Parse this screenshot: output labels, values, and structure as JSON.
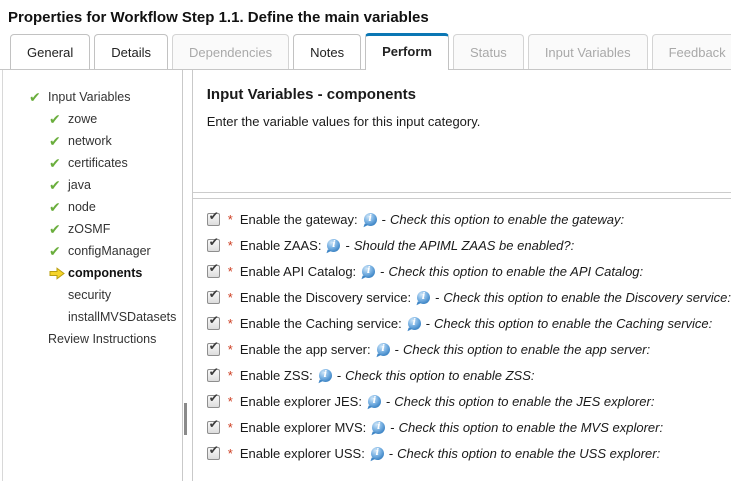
{
  "title": "Properties for Workflow Step 1.1. Define the main variables",
  "tabs": [
    {
      "label": "General",
      "state": "enabled"
    },
    {
      "label": "Details",
      "state": "enabled"
    },
    {
      "label": "Dependencies",
      "state": "disabled"
    },
    {
      "label": "Notes",
      "state": "enabled"
    },
    {
      "label": "Perform",
      "state": "active"
    },
    {
      "label": "Status",
      "state": "disabled"
    },
    {
      "label": "Input Variables",
      "state": "disabled"
    },
    {
      "label": "Feedback",
      "state": "disabled"
    }
  ],
  "sidebar": {
    "items": [
      {
        "label": "Input Variables",
        "icon": "check",
        "level": 0,
        "bold": false,
        "selected": false
      },
      {
        "label": "zowe",
        "icon": "check",
        "level": 1,
        "bold": false,
        "selected": false
      },
      {
        "label": "network",
        "icon": "check",
        "level": 1,
        "bold": false,
        "selected": false
      },
      {
        "label": "certificates",
        "icon": "check",
        "level": 1,
        "bold": false,
        "selected": false
      },
      {
        "label": "java",
        "icon": "check",
        "level": 1,
        "bold": false,
        "selected": false
      },
      {
        "label": "node",
        "icon": "check",
        "level": 1,
        "bold": false,
        "selected": false
      },
      {
        "label": "zOSMF",
        "icon": "check",
        "level": 1,
        "bold": false,
        "selected": false
      },
      {
        "label": "configManager",
        "icon": "check",
        "level": 1,
        "bold": false,
        "selected": false
      },
      {
        "label": "components",
        "icon": "arrow",
        "level": 1,
        "bold": true,
        "selected": true
      },
      {
        "label": "security",
        "icon": "none",
        "level": 1,
        "bold": false,
        "selected": false
      },
      {
        "label": "installMVSDatasets",
        "icon": "none",
        "level": 1,
        "bold": false,
        "selected": false
      },
      {
        "label": "Review Instructions",
        "icon": "none",
        "level": 0,
        "bold": false,
        "selected": false
      }
    ]
  },
  "main": {
    "heading": "Input Variables - components",
    "subheading": "Enter the variable values for this input category.",
    "required_marker": "*",
    "separator": "-",
    "rows": [
      {
        "label": "Enable the gateway:",
        "description": "Check this option to enable the gateway:",
        "checked": true,
        "required": true
      },
      {
        "label": "Enable ZAAS:",
        "description": "Should the APIML ZAAS be enabled?:",
        "checked": true,
        "required": true
      },
      {
        "label": "Enable API Catalog:",
        "description": "Check this option to enable the API Catalog:",
        "checked": true,
        "required": true
      },
      {
        "label": "Enable the Discovery service:",
        "description": "Check this option to enable the Discovery service:",
        "checked": true,
        "required": true
      },
      {
        "label": "Enable the Caching service:",
        "description": "Check this option to enable the Caching service:",
        "checked": true,
        "required": true
      },
      {
        "label": "Enable the app server:",
        "description": "Check this option to enable the app server:",
        "checked": true,
        "required": true
      },
      {
        "label": "Enable ZSS:",
        "description": "Check this option to enable ZSS:",
        "checked": true,
        "required": true
      },
      {
        "label": "Enable explorer JES:",
        "description": "Check this option to enable the JES explorer:",
        "checked": true,
        "required": true
      },
      {
        "label": "Enable explorer MVS:",
        "description": "Check this option to enable the MVS explorer:",
        "checked": true,
        "required": true
      },
      {
        "label": "Enable explorer USS:",
        "description": "Check this option to enable the USS explorer:",
        "checked": true,
        "required": true
      }
    ]
  },
  "icons": {
    "complete": "check-icon",
    "current": "arrow-right-icon",
    "help": "info-icon"
  },
  "colors": {
    "active_tab_accent": "#0b77b4",
    "complete_green": "#6aae3d",
    "current_yellow": "#f6d42a",
    "required_red": "#cc3b1e",
    "info_blue": "#3f86c6",
    "border_gray": "#c9c9c9",
    "disabled_text": "#a9a9a9"
  }
}
